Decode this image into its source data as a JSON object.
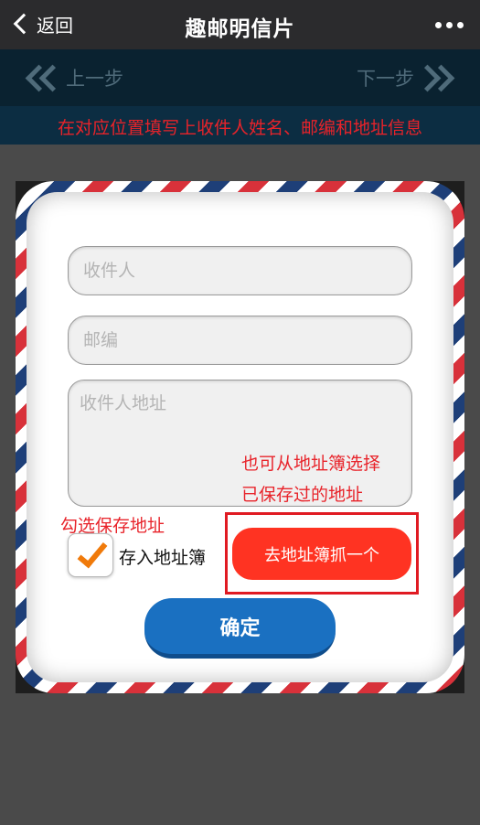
{
  "navbar": {
    "back_label": "返回",
    "title": "趣邮明信片",
    "more_icon": "more-dots-icon"
  },
  "steps": {
    "prev_label": "上一步",
    "next_label": "下一步"
  },
  "hint": "在对应位置填写上收件人姓名、邮编和地址信息",
  "form": {
    "recipient_placeholder": "收件人",
    "postcode_placeholder": "邮编",
    "address_placeholder": "收件人地址",
    "save_checkbox_label": "存入地址簿",
    "save_checked": true,
    "addressbook_button": "去地址簿抓一个",
    "confirm_button": "确定"
  },
  "annotations": {
    "addressbook_line1": "也可从地址簿选择",
    "addressbook_line2": "已保存过的地址",
    "save_hint": "勾选保存地址"
  },
  "colors": {
    "annotation_red": "#e8232a",
    "confirm_blue": "#1a70c1",
    "addressbook_red": "#ff3322",
    "checkmark_orange": "#f07a0a"
  }
}
